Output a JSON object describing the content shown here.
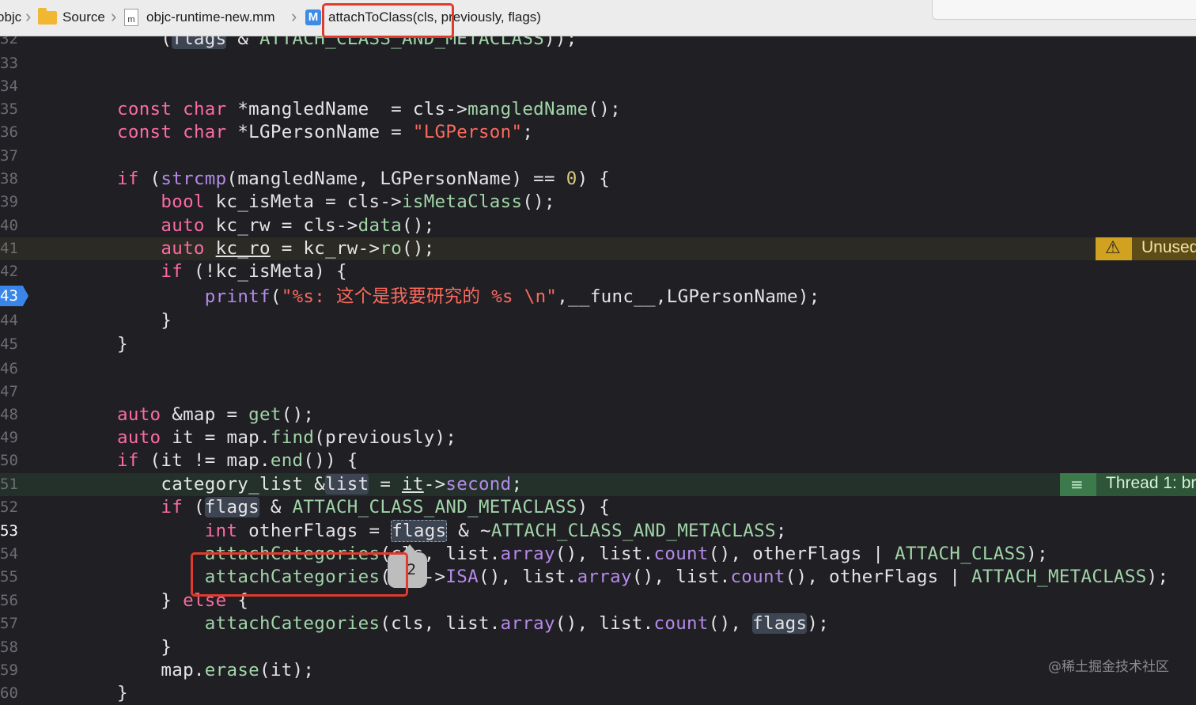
{
  "breadcrumb": {
    "items": [
      "objc",
      "Source",
      "objc-runtime-new.mm",
      "attachToClass(cls, previously, flags)"
    ],
    "method_badge": "M",
    "file_badge": "m"
  },
  "lines": [
    {
      "num": "32",
      "code": "        (flags & ATTACH_CLASS_AND_METACLASS));"
    },
    {
      "num": "33",
      "code": ""
    },
    {
      "num": "34",
      "code": ""
    },
    {
      "num": "35",
      "code": "const char *mangledName  = cls->mangledName();"
    },
    {
      "num": "36",
      "code": "const char *LGPersonName = \"LGPerson\";"
    },
    {
      "num": "37",
      "code": ""
    },
    {
      "num": "38",
      "code": "if (strcmp(mangledName, LGPersonName) == 0) {"
    },
    {
      "num": "39",
      "code": "    bool kc_isMeta = cls->isMetaClass();"
    },
    {
      "num": "40",
      "code": "    auto kc_rw = cls->data();"
    },
    {
      "num": "41",
      "code": "    auto kc_ro = kc_rw->ro();"
    },
    {
      "num": "42",
      "code": "    if (!kc_isMeta) {"
    },
    {
      "num": "43",
      "code": "        printf(\"%s: 这个是我要研究的 %s \\n\",__func__,LGPersonName);"
    },
    {
      "num": "44",
      "code": "    }"
    },
    {
      "num": "45",
      "code": "}"
    },
    {
      "num": "46",
      "code": ""
    },
    {
      "num": "47",
      "code": ""
    },
    {
      "num": "48",
      "code": "auto &map = get();"
    },
    {
      "num": "49",
      "code": "auto it = map.find(previously);"
    },
    {
      "num": "50",
      "code": "if (it != map.end()) {"
    },
    {
      "num": "51",
      "code": "    category_list &list = it->second;"
    },
    {
      "num": "52",
      "code": "    if (flags & ATTACH_CLASS_AND_METACLASS) {"
    },
    {
      "num": "53",
      "code": "        int otherFlags = flags & ~ATTACH_CLASS_AND_METACLASS;"
    },
    {
      "num": "54",
      "code": "        attachCategories(cls, list.array(), list.count(), otherFlags | ATTACH_CLASS);"
    },
    {
      "num": "55",
      "code": "        attachCategories(cls->ISA(), list.array(), list.count(), otherFlags | ATTACH_METACLASS);"
    },
    {
      "num": "56",
      "code": "    } else {"
    },
    {
      "num": "57",
      "code": "        attachCategories(cls, list.array(), list.count(), flags);"
    },
    {
      "num": "58",
      "code": "    }"
    },
    {
      "num": "59",
      "code": "    map.erase(it);"
    },
    {
      "num": "60",
      "code": "}"
    }
  ],
  "annotations": {
    "warning_label": "Unused",
    "warning_icon": "warning-triangle-icon",
    "thread_label": "Thread 1: br",
    "thread_icon": "lines-icon",
    "breakpoint_line": "43",
    "tooltip_digit": "2"
  },
  "watermark": "@稀土掘金技术社区",
  "colors": {
    "editor_bg": "#1f1f24",
    "keyword": "#fc6ba3",
    "function": "#b58ae8",
    "string": "#fc6a5d",
    "number": "#d9c97c",
    "highlight_box": "#e03b2d",
    "breakpoint": "#3a86e8"
  }
}
